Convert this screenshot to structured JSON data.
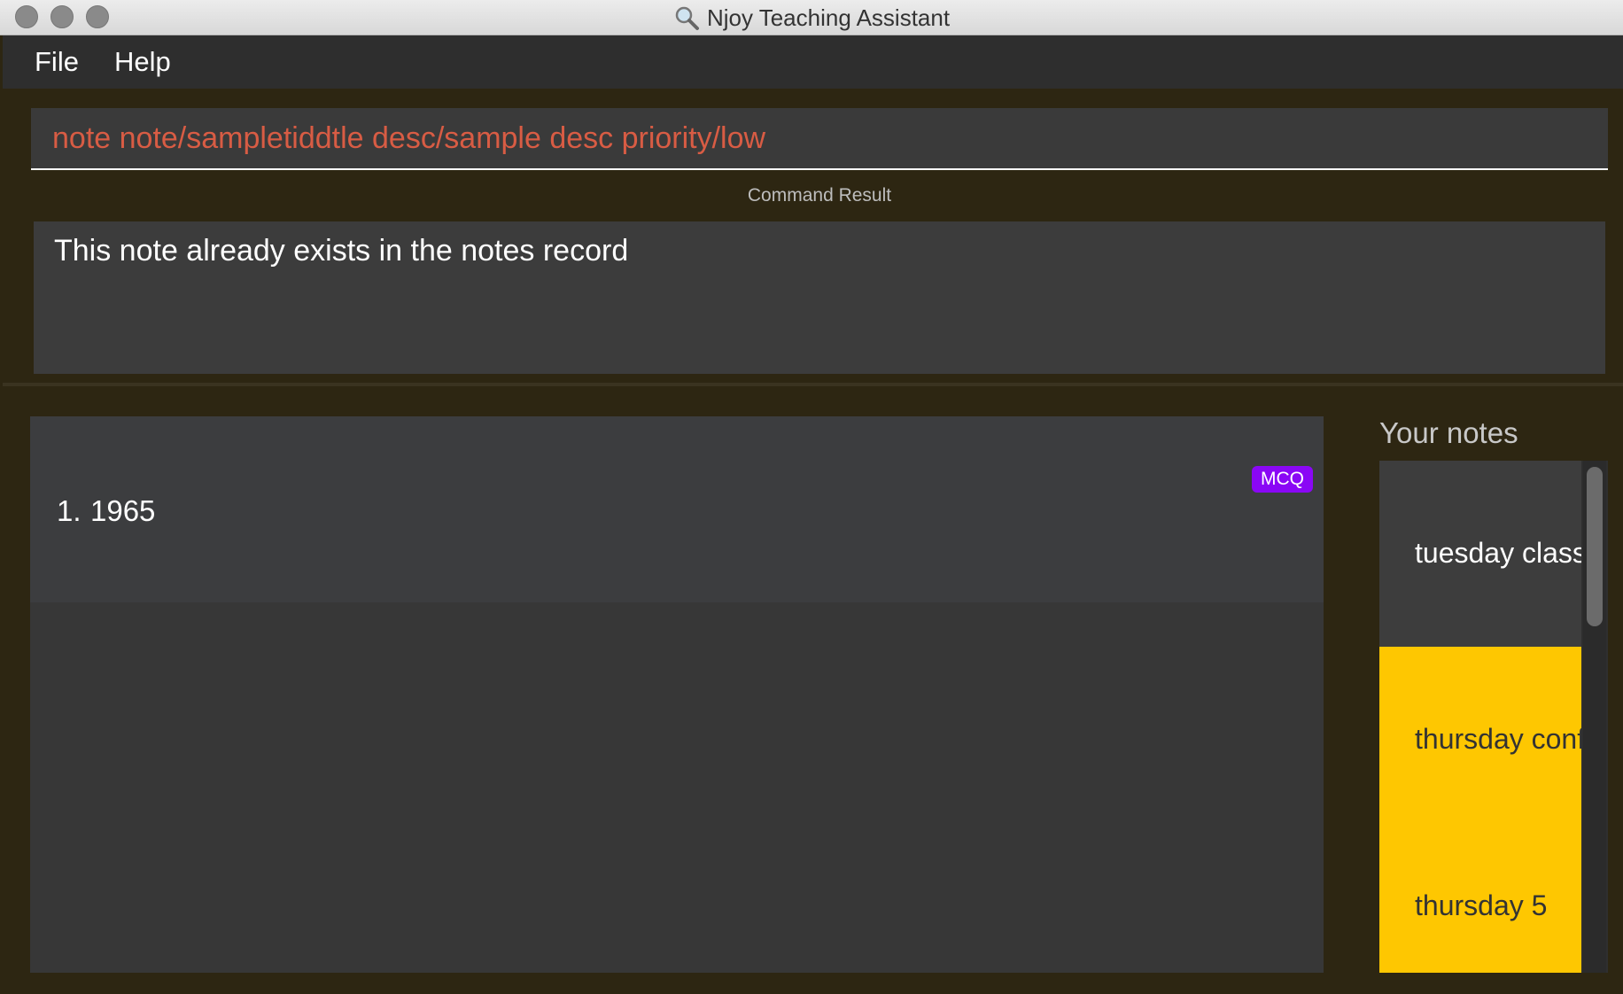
{
  "window": {
    "title": "Njoy Teaching Assistant"
  },
  "menu": {
    "file": "File",
    "help": "Help"
  },
  "command": {
    "value": "note note/sampletiddtle desc/sample desc priority/low"
  },
  "result": {
    "label": "Command Result",
    "message": "This note already exists in the notes record"
  },
  "list": {
    "items": [
      {
        "index": "1.",
        "text": "1965",
        "tag": "MCQ"
      }
    ]
  },
  "notes": {
    "title": "Your notes",
    "items": [
      {
        "label": "tuesday class",
        "color": "#3d3d3d"
      },
      {
        "label": "thursday conf",
        "color": "#fec701"
      },
      {
        "label": "thursday 5",
        "color": "#fec701"
      }
    ]
  },
  "colors": {
    "accent_tag": "#8a07f5",
    "note_highlight": "#fec701",
    "command_text": "#d85c44"
  }
}
